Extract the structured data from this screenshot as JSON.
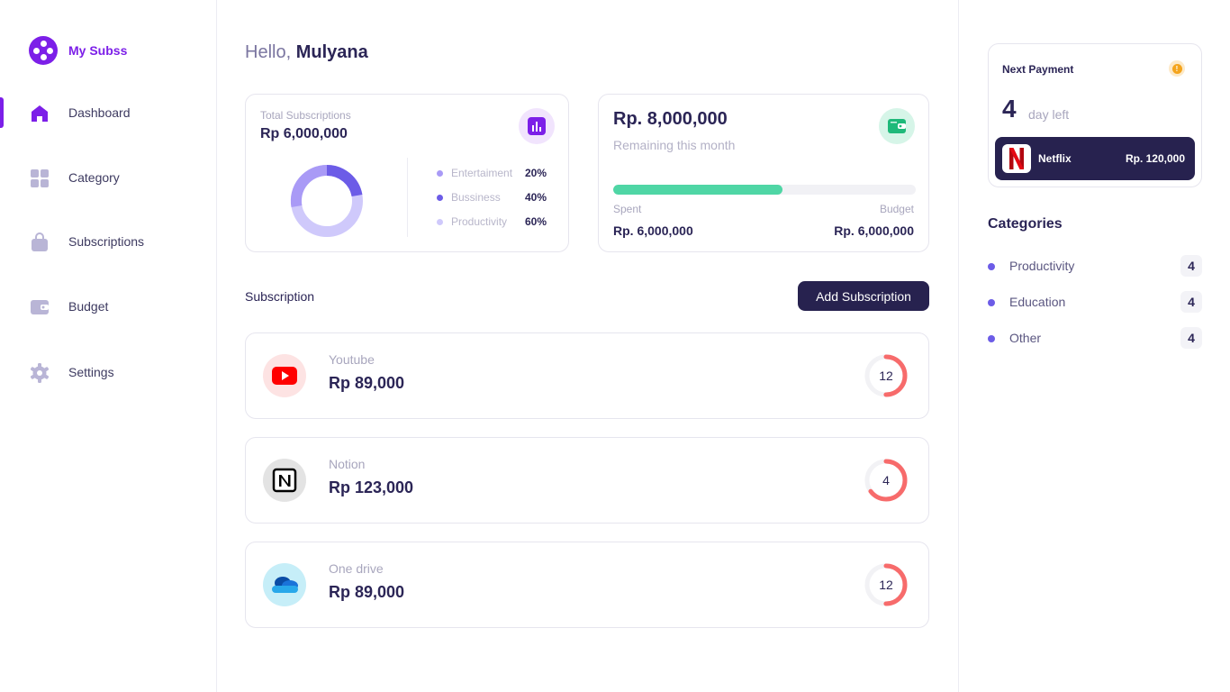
{
  "app": {
    "name": "My Subss",
    "brand_color": "#7c1fe8"
  },
  "sidebar": {
    "items": [
      {
        "label": "Dashboard",
        "icon": "home-icon",
        "active": true
      },
      {
        "label": "Category",
        "icon": "grid-icon",
        "active": false
      },
      {
        "label": "Subscriptions",
        "icon": "bag-icon",
        "active": false
      },
      {
        "label": "Budget",
        "icon": "wallet-icon",
        "active": false
      },
      {
        "label": "Settings",
        "icon": "gear-icon",
        "active": false
      }
    ]
  },
  "greeting": {
    "prefix": "Hello,",
    "name": "Mulyana"
  },
  "total_card": {
    "label": "Total Subscriptions",
    "value": "Rp 6,000,000",
    "icon": "bar-chart-icon",
    "legend": [
      {
        "name": "Entertaiment",
        "value": "20%",
        "color": "#a99af6"
      },
      {
        "name": "Bussiness",
        "value": "40%",
        "color": "#6c5ce7"
      },
      {
        "name": "Productivity",
        "value": "60%",
        "color": "#cfc9fb"
      }
    ]
  },
  "budget_card": {
    "amount": "Rp. 8,000,000",
    "subtitle": "Remaining this month",
    "icon": "wallet-icon",
    "progress": 0.56,
    "spent_label": "Spent",
    "spent_value": "Rp. 6,000,000",
    "budget_label": "Budget",
    "budget_value": "Rp. 6,000,000"
  },
  "subscriptions": {
    "title": "Subscription",
    "add_button": "Add Subscription",
    "items": [
      {
        "name": "Youtube",
        "price": "Rp 89,000",
        "count": "12",
        "icon": "youtube-icon",
        "ring_fraction": 0.5
      },
      {
        "name": "Notion",
        "price": "Rp 123,000",
        "count": "4",
        "icon": "notion-icon",
        "ring_fraction": 0.65
      },
      {
        "name": "One drive",
        "price": "Rp 89,000",
        "count": "12",
        "icon": "onedrive-icon",
        "ring_fraction": 0.5
      }
    ]
  },
  "next_payment": {
    "title": "Next Payment",
    "days": "4",
    "days_label": "day left",
    "service": "Netflix",
    "price": "Rp. 120,000",
    "icon": "netflix-icon"
  },
  "categories": {
    "title": "Categories",
    "items": [
      {
        "name": "Productivity",
        "count": "4"
      },
      {
        "name": "Education",
        "count": "4"
      },
      {
        "name": "Other",
        "count": "4"
      }
    ]
  }
}
